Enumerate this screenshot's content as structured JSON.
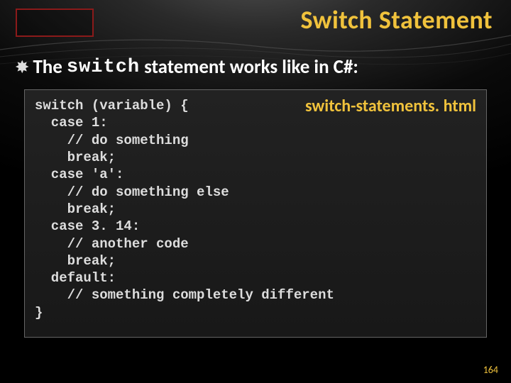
{
  "title": "Switch Statement",
  "bullet": {
    "pre": "The",
    "kw": "switch",
    "post": "statement works like in C#:"
  },
  "code": "switch (variable) {\n  case 1:\n    // do something\n    break;\n  case 'a':\n    // do something else\n    break;\n  case 3. 14:\n    // another code\n    break;\n  default:\n    // something completely different\n}",
  "filename": "switch-statements. html",
  "page_number": "164"
}
